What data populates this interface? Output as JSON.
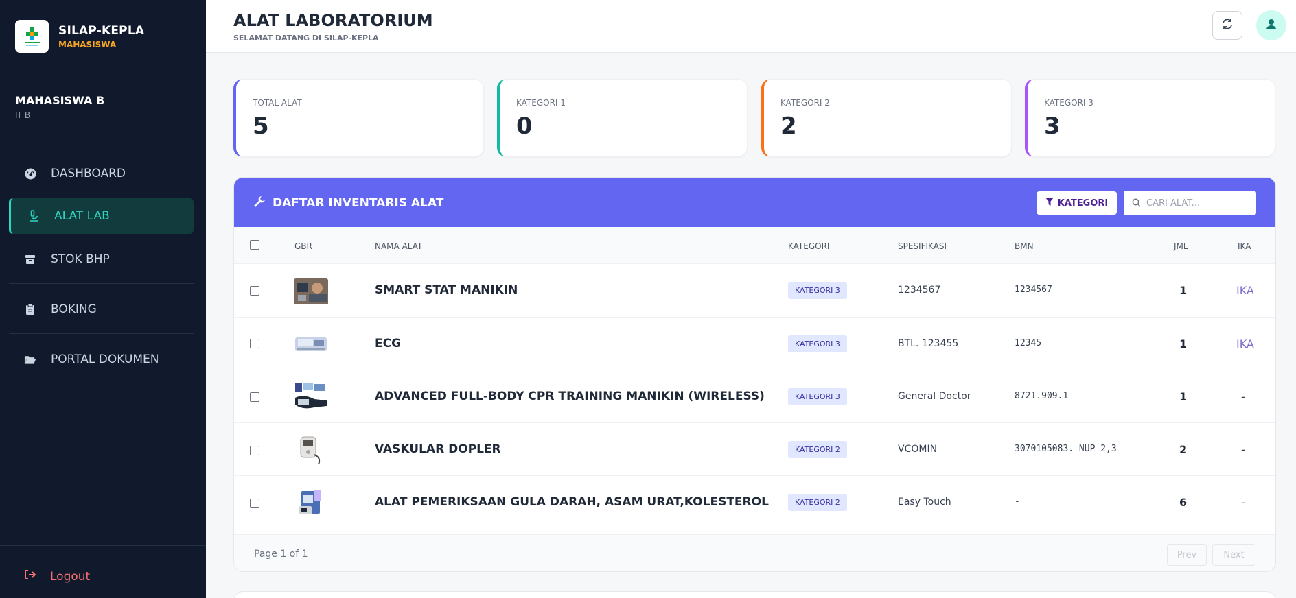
{
  "brand": {
    "title": "SILAP-KEPLA",
    "subtitle": "MAHASISWA"
  },
  "user": {
    "name": "MAHASISWA B",
    "class": "II B"
  },
  "nav": [
    {
      "label": "DASHBOARD",
      "icon": "dashboard-icon"
    },
    {
      "label": "ALAT LAB",
      "icon": "microscope-icon",
      "active": true
    },
    {
      "label": "STOK BHP",
      "icon": "box-icon"
    },
    {
      "label": "BOKING",
      "icon": "clipboard-icon"
    },
    {
      "label": "PORTAL DOKUMEN",
      "icon": "folder-open-icon"
    }
  ],
  "logout_label": "Logout",
  "header": {
    "title": "ALAT LABORATORIUM",
    "subtitle": "SELAMAT DATANG DI SILAP-KEPLA"
  },
  "stats": [
    {
      "label": "TOTAL ALAT",
      "value": "5",
      "color": "#6366f1"
    },
    {
      "label": "KATEGORI 1",
      "value": "0",
      "color": "#14b8a6"
    },
    {
      "label": "KATEGORI 2",
      "value": "2",
      "color": "#f97316"
    },
    {
      "label": "KATEGORI 3",
      "value": "3",
      "color": "#a855f7"
    }
  ],
  "panel": {
    "title": "DAFTAR INVENTARIS ALAT",
    "filter_label": "KATEGORI",
    "search_placeholder": "CARI ALAT..."
  },
  "table": {
    "headers": [
      "GBR",
      "NAMA ALAT",
      "KATEGORI",
      "SPESIFIKASI",
      "BMN",
      "JML",
      "IKA"
    ],
    "rows": [
      {
        "name": "SMART STAT MANIKIN",
        "kategori": "KATEGORI 3",
        "spesifikasi": "1234567",
        "bmn": "1234567",
        "jml": "1",
        "ika": "IKA"
      },
      {
        "name": "ECG",
        "kategori": "KATEGORI 3",
        "spesifikasi": "BTL. 123455",
        "bmn": "12345",
        "jml": "1",
        "ika": "IKA"
      },
      {
        "name": "ADVANCED FULL-BODY CPR TRAINING MANIKIN (WIRELESS)",
        "kategori": "KATEGORI 3",
        "spesifikasi": "General Doctor",
        "bmn": "8721.909.1",
        "jml": "1",
        "ika": "-"
      },
      {
        "name": "VASKULAR DOPLER",
        "kategori": "KATEGORI 2",
        "spesifikasi": "VCOMIN",
        "bmn": "3070105083. NUP 2,3",
        "jml": "2",
        "ika": "-"
      },
      {
        "name": "ALAT PEMERIKSAAN GULA DARAH, ASAM URAT,KOLESTEROL",
        "kategori": "KATEGORI 2",
        "spesifikasi": "Easy Touch",
        "bmn": "-",
        "jml": "6",
        "ika": "-"
      }
    ]
  },
  "pagination": {
    "info": "Page 1 of 1",
    "prev": "Prev",
    "next": "Next"
  }
}
